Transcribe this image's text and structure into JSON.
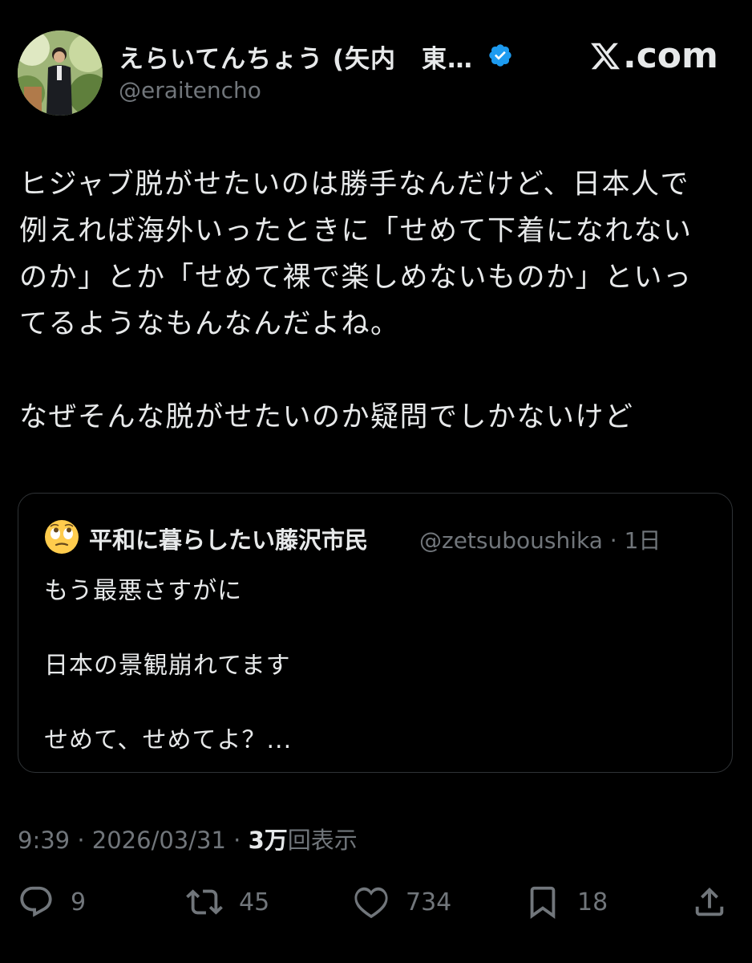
{
  "header": {
    "display_name": "えらいてんちょう (矢内　東…",
    "handle": "@eraitencho",
    "site_logo": ".com",
    "verified_color": "#1d9bf0"
  },
  "tweet": {
    "lines": [
      "ヒジャブ脱がせたいのは勝手なんだけど、日本人で",
      "例えれば海外いったときに「せめて下着になれない",
      "のか」とか「せめて裸で楽しめないものか」といっ",
      "てるようなもんなんだよね。",
      "なぜそんな脱がせたいのか疑問でしかないけど"
    ]
  },
  "quote": {
    "emoji": "face-with-rolling-eyes",
    "name": "平和に暮らしたい藤沢市民",
    "handle_time": "@zetsuboushika · 1日",
    "lines": [
      "もう最悪さすがに",
      "日本の景観崩れてます",
      "せめて、せめてよ？..."
    ]
  },
  "meta": {
    "time_date": "9:39 · 2026/03/31 · ",
    "views_count": "3万",
    "views_label": "回表示"
  },
  "actions": {
    "replies": "9",
    "reposts": "45",
    "likes": "734",
    "bookmarks": "18"
  }
}
